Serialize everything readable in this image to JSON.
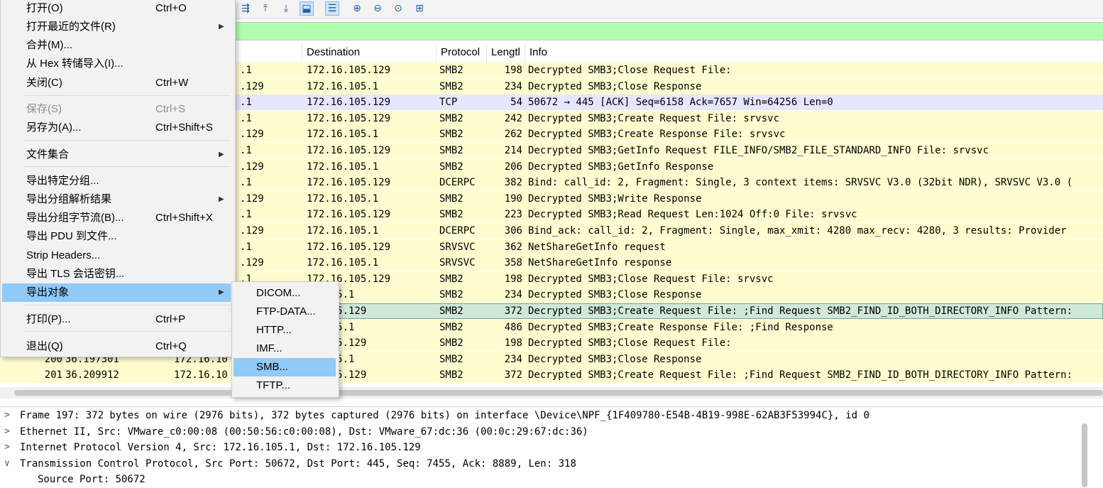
{
  "colors": {
    "smb2_row": "#fffdcf",
    "tcp_row": "#e7e6ff",
    "selected_row": "#d0e8d8",
    "filter_bg": "#afffaf",
    "menu_highlight": "#91c9f7"
  },
  "toolbar": {
    "icons": [
      "go-to-packet-icon",
      "first-packet-icon",
      "last-packet-icon",
      "auto-scroll-icon",
      "colorize-icon",
      "zoom-in-icon",
      "zoom-out-icon",
      "zoom-normal-icon",
      "resize-columns-icon"
    ]
  },
  "packet_list": {
    "headers": {
      "destination": "Destination",
      "protocol": "Protocol",
      "length": "Lengtl",
      "info": "Info"
    },
    "rows": [
      {
        "src": ".1",
        "dst": "172.16.105.129",
        "proto": "SMB2",
        "len": "198",
        "info": "Decrypted SMB3;Close Request File:",
        "color": "smb"
      },
      {
        "src": ".129",
        "dst": "172.16.105.1",
        "proto": "SMB2",
        "len": "234",
        "info": "Decrypted SMB3;Close Response",
        "color": "smb"
      },
      {
        "src": ".1",
        "dst": "172.16.105.129",
        "proto": "TCP",
        "len": "54",
        "info": "50672 → 445 [ACK] Seq=6158 Ack=7657 Win=64256 Len=0",
        "color": "tcp"
      },
      {
        "src": ".1",
        "dst": "172.16.105.129",
        "proto": "SMB2",
        "len": "242",
        "info": "Decrypted SMB3;Create Request File: srvsvc",
        "color": "smb"
      },
      {
        "src": ".129",
        "dst": "172.16.105.1",
        "proto": "SMB2",
        "len": "262",
        "info": "Decrypted SMB3;Create Response File: srvsvc",
        "color": "smb"
      },
      {
        "src": ".1",
        "dst": "172.16.105.129",
        "proto": "SMB2",
        "len": "214",
        "info": "Decrypted SMB3;GetInfo Request FILE_INFO/SMB2_FILE_STANDARD_INFO File: srvsvc",
        "color": "smb"
      },
      {
        "src": ".129",
        "dst": "172.16.105.1",
        "proto": "SMB2",
        "len": "206",
        "info": "Decrypted SMB3;GetInfo Response",
        "color": "smb"
      },
      {
        "src": ".1",
        "dst": "172.16.105.129",
        "proto": "DCERPC",
        "len": "382",
        "info": "Bind: call_id: 2, Fragment: Single, 3 context items: SRVSVC V3.0 (32bit NDR), SRVSVC V3.0 (",
        "color": "smb"
      },
      {
        "src": ".129",
        "dst": "172.16.105.1",
        "proto": "SMB2",
        "len": "190",
        "info": "Decrypted SMB3;Write Response",
        "color": "smb"
      },
      {
        "src": ".1",
        "dst": "172.16.105.129",
        "proto": "SMB2",
        "len": "223",
        "info": "Decrypted SMB3;Read Request Len:1024 Off:0 File: srvsvc",
        "color": "smb"
      },
      {
        "src": ".129",
        "dst": "172.16.105.1",
        "proto": "DCERPC",
        "len": "306",
        "info": "Bind_ack: call_id: 2, Fragment: Single, max_xmit: 4280 max_recv: 4280, 3 results: Provider",
        "color": "smb"
      },
      {
        "src": ".1",
        "dst": "172.16.105.129",
        "proto": "SRVSVC",
        "len": "362",
        "info": "NetShareGetInfo request",
        "color": "smb"
      },
      {
        "src": ".129",
        "dst": "172.16.105.1",
        "proto": "SRVSVC",
        "len": "358",
        "info": "NetShareGetInfo response",
        "color": "smb"
      },
      {
        "src": ".1",
        "dst": "172.16.105.129",
        "proto": "SMB2",
        "len": "198",
        "info": "Decrypted SMB3;Close Request File: srvsvc",
        "color": "smb"
      },
      {
        "src": "",
        "dst": "16.105.1",
        "proto": "SMB2",
        "len": "234",
        "info": "Decrypted SMB3;Close Response",
        "color": "smb"
      },
      {
        "src": "",
        "dst": "16.105.129",
        "proto": "SMB2",
        "len": "372",
        "info": "Decrypted SMB3;Create Request File: ;Find Request SMB2_FIND_ID_BOTH_DIRECTORY_INFO Pattern:",
        "color": "selected"
      },
      {
        "src": "",
        "dst": "16.105.1",
        "proto": "SMB2",
        "len": "486",
        "info": "Decrypted SMB3;Create Response File: ;Find Response",
        "color": "smb"
      },
      {
        "src": "",
        "dst": "16.105.129",
        "proto": "SMB2",
        "len": "198",
        "info": "Decrypted SMB3;Close Request File:",
        "color": "smb"
      },
      {
        "no": "200",
        "time": "36.197301",
        "src": "172.16.10",
        "dst": "16.105.1",
        "proto": "SMB2",
        "len": "234",
        "info": "Decrypted SMB3;Close Response",
        "color": "smb"
      },
      {
        "no": "201",
        "time": "36.209912",
        "src": "172.16.10",
        "dst": "16.105.129",
        "proto": "SMB2",
        "len": "372",
        "info": "Decrypted SMB3;Create Request File: ;Find Request SMB2_FIND_ID_BOTH_DIRECTORY_INFO Pattern:",
        "color": "smb"
      }
    ]
  },
  "details": {
    "rows": [
      {
        "arrow": ">",
        "text": "Frame 197: 372 bytes on wire (2976 bits), 372 bytes captured (2976 bits) on interface \\Device\\NPF_{1F409780-E54B-4B19-998E-62AB3F53994C}, id 0"
      },
      {
        "arrow": ">",
        "text": "Ethernet II, Src: VMware_c0:00:08 (00:50:56:c0:00:08), Dst: VMware_67:dc:36 (00:0c:29:67:dc:36)"
      },
      {
        "arrow": ">",
        "text": "Internet Protocol Version 4, Src: 172.16.105.1, Dst: 172.16.105.129"
      },
      {
        "arrow": "∨",
        "text": "Transmission Control Protocol, Src Port: 50672, Dst Port: 445, Seq: 7455, Ack: 8889, Len: 318"
      },
      {
        "arrow": "",
        "text": "Source Port: 50672"
      }
    ]
  },
  "file_menu": {
    "items": [
      {
        "label": "打开(O)",
        "shortcut": "Ctrl+O"
      },
      {
        "label": "打开最近的文件(R)",
        "submenu": true
      },
      {
        "label": "合并(M)..."
      },
      {
        "label": "从 Hex 转储导入(I)..."
      },
      {
        "label": "关闭(C)",
        "shortcut": "Ctrl+W"
      },
      {
        "label": "保存(S)",
        "shortcut": "Ctrl+S",
        "disabled": true
      },
      {
        "label": "另存为(A)...",
        "shortcut": "Ctrl+Shift+S"
      },
      {
        "label": "文件集合",
        "submenu": true
      },
      {
        "label": "导出特定分组..."
      },
      {
        "label": "导出分组解析结果",
        "submenu": true
      },
      {
        "label": "导出分组字节流(B)...",
        "shortcut": "Ctrl+Shift+X"
      },
      {
        "label": "导出 PDU 到文件..."
      },
      {
        "label": "Strip Headers..."
      },
      {
        "label": "导出 TLS 会话密钥..."
      },
      {
        "label": "导出对象",
        "submenu": true,
        "active": true
      },
      {
        "label": "打印(P)...",
        "shortcut": "Ctrl+P"
      },
      {
        "label": "退出(Q)",
        "shortcut": "Ctrl+Q"
      }
    ]
  },
  "export_objects_menu": {
    "items": [
      {
        "label": "DICOM..."
      },
      {
        "label": "FTP-DATA..."
      },
      {
        "label": "HTTP..."
      },
      {
        "label": "IMF..."
      },
      {
        "label": "SMB...",
        "active": true
      },
      {
        "label": "TFTP..."
      }
    ]
  }
}
